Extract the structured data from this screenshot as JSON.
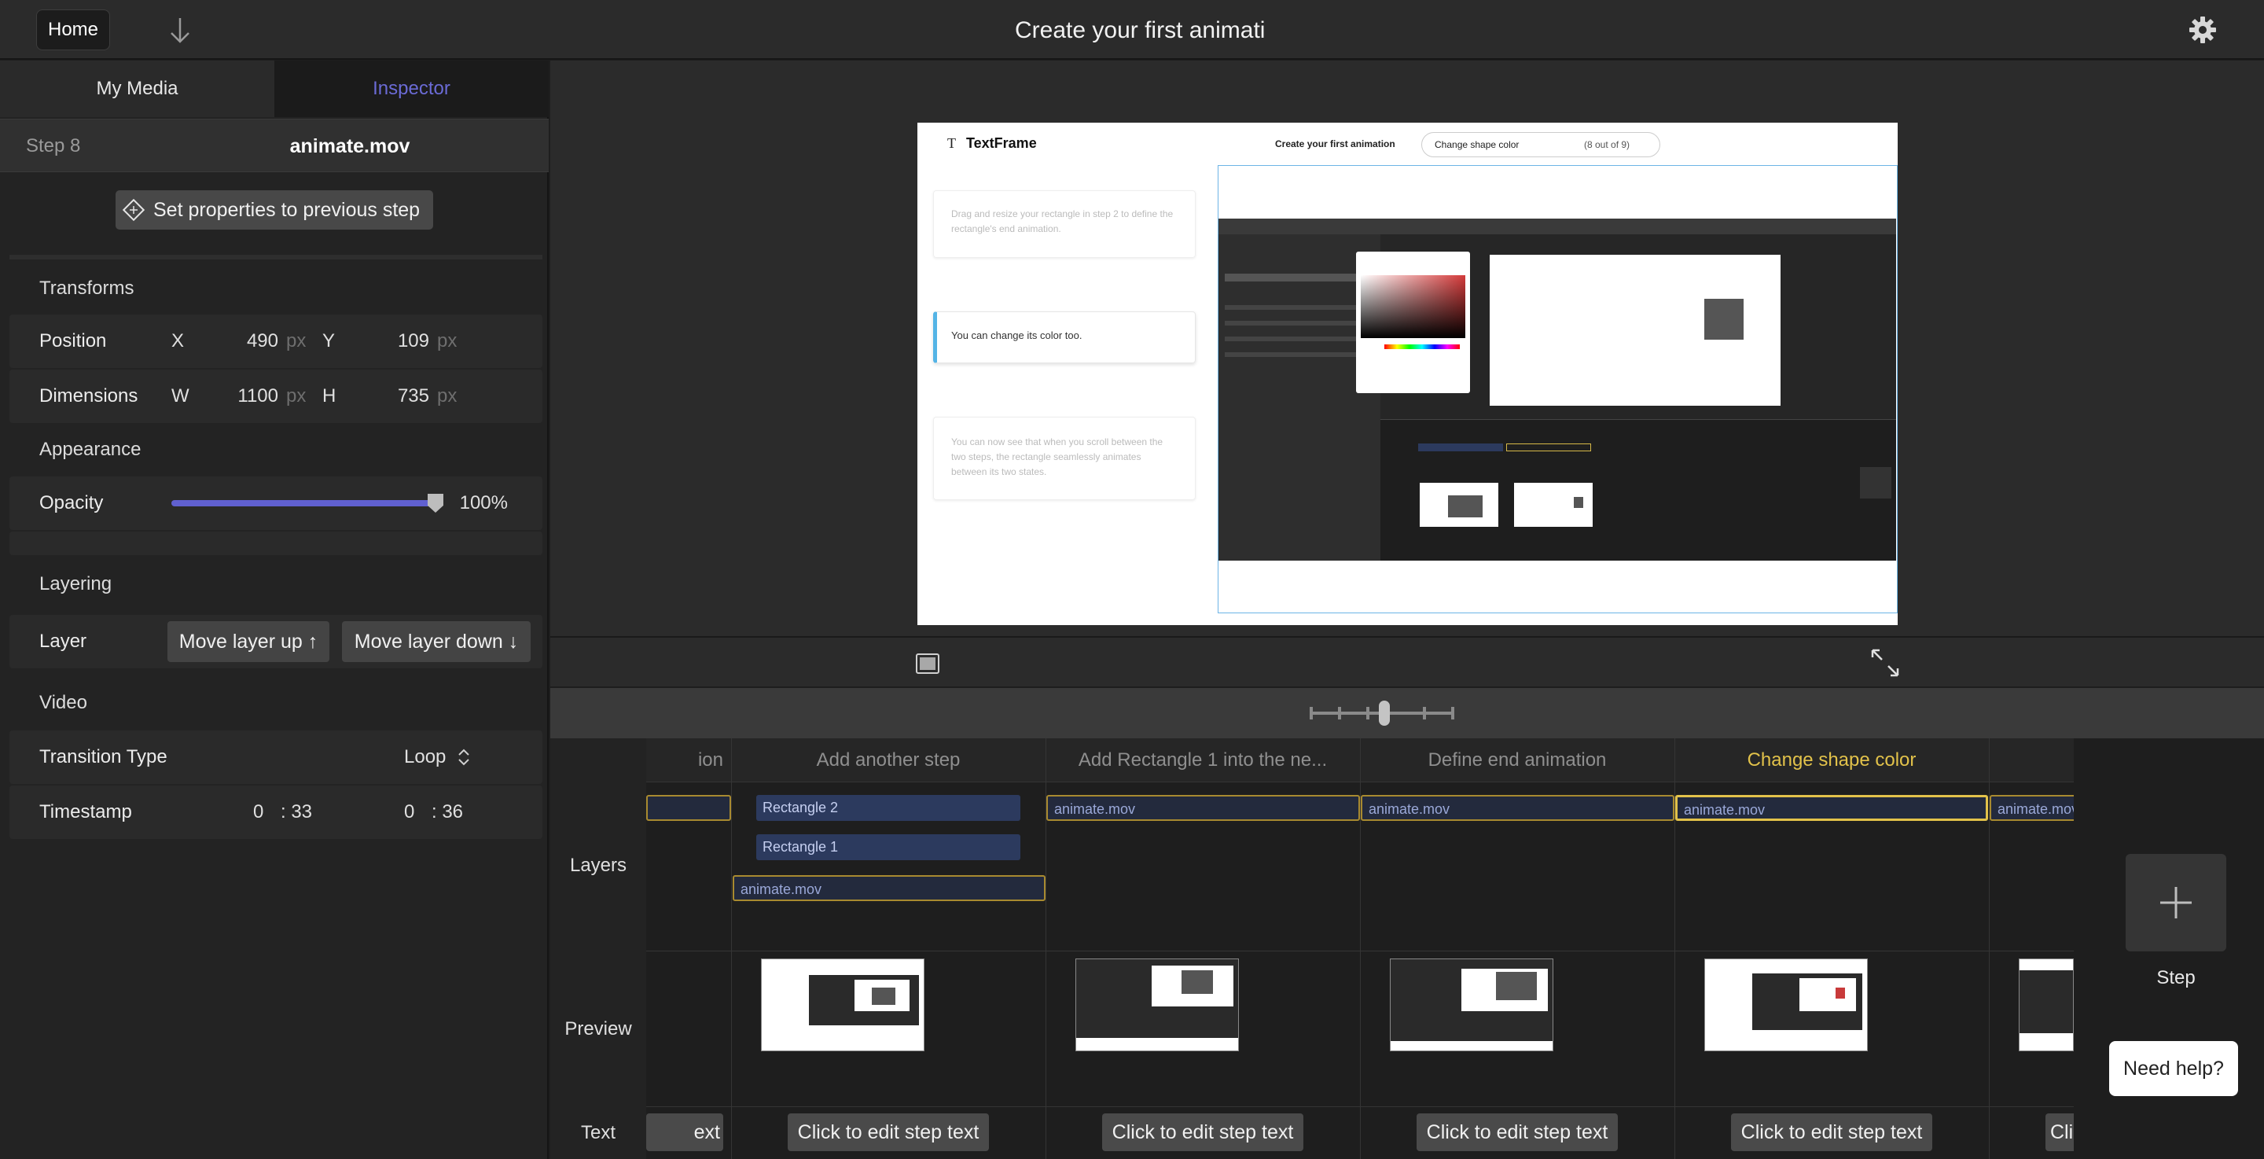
{
  "topbar": {
    "home_label": "Home",
    "title": "Create your first animation"
  },
  "left": {
    "tabs": [
      "My Media",
      "Inspector"
    ],
    "step_label": "Step 8",
    "file_name": "animate.mov",
    "set_props_label": "Set properties to previous step",
    "transforms_title": "Transforms",
    "position": {
      "label": "Position",
      "x_letter": "X",
      "x": "490",
      "y_letter": "Y",
      "y": "109",
      "unit": "px"
    },
    "dimensions": {
      "label": "Dimensions",
      "w_letter": "W",
      "w": "1100",
      "h_letter": "H",
      "h": "735",
      "unit": "px"
    },
    "appearance_title": "Appearance",
    "opacity": {
      "label": "Opacity",
      "value": "100%",
      "level": 1.0
    },
    "layering_title": "Layering",
    "layer": {
      "label": "Layer",
      "up": "Move layer up ↑",
      "down": "Move layer down ↓"
    },
    "video_title": "Video",
    "transition": {
      "label": "Transition Type",
      "value": "Loop"
    },
    "timestamp": {
      "label": "Timestamp",
      "start_m": "0",
      "start_s": ": 33",
      "end_m": "0",
      "end_s": ": 36"
    }
  },
  "canvas": {
    "brand": "TextFrame",
    "crumb_title": "Create your first animation",
    "crumb_step": "Change shape color",
    "crumb_count": "(8 out of 9)",
    "cards": [
      "Drag and resize your rectangle in step 2 to define the rectangle's end animation.",
      "You can change its color too.",
      "You can now see that when you scroll between the two steps, the rectangle seamlessly animates between its two states."
    ]
  },
  "timeline": {
    "row_labels": [
      "Layers",
      "Preview",
      "Text"
    ],
    "columns": [
      {
        "title": "ion",
        "active": false
      },
      {
        "title": "Add another step",
        "active": false
      },
      {
        "title": "Add Rectangle 1 into the ne...",
        "active": false
      },
      {
        "title": "Define end animation",
        "active": false
      },
      {
        "title": "Change shape color",
        "active": true
      }
    ],
    "clips": {
      "mov": "animate.mov",
      "rect2": "Rectangle 2",
      "rect1": "Rectangle 1"
    },
    "edit_label": "Click to edit step text",
    "edit_partial_left": "ext",
    "edit_partial_right": "Cli",
    "add_step_label": "Step"
  },
  "help_label": "Need help?",
  "colors": {
    "accent": "#6b6bd6",
    "active_step": "#e2c24a",
    "clip_border": "#a88a30"
  }
}
